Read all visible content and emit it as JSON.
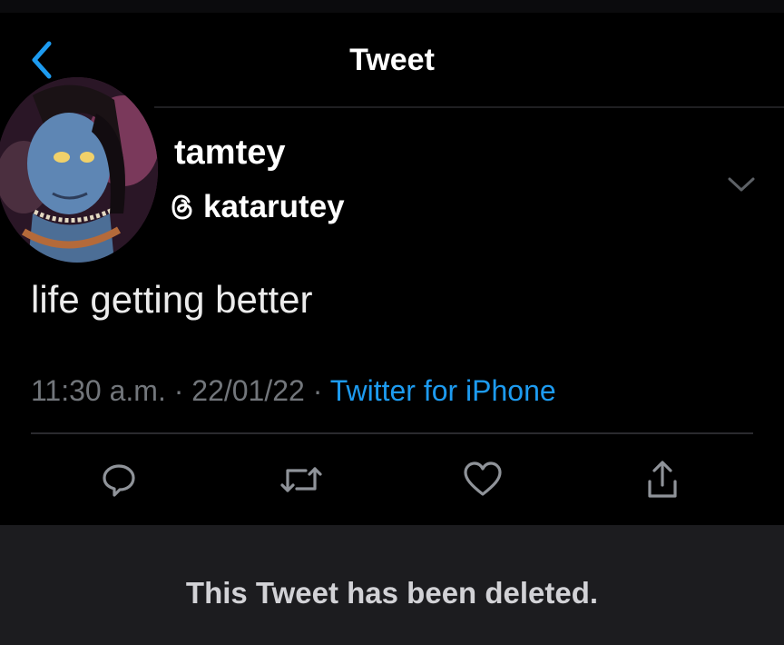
{
  "nav": {
    "title": "Tweet",
    "back_icon": "chevron-left-icon"
  },
  "tweet": {
    "display_name": "tamtey",
    "handle_prefix_icon": "threads-logo-icon",
    "handle": "katarutey",
    "text": "life getting better",
    "time": "11:30 a.m.",
    "separator": "·",
    "date": "22/01/22",
    "source": "Twitter for iPhone"
  },
  "actions": [
    "reply-icon",
    "retweet-icon",
    "like-icon",
    "share-icon"
  ],
  "deleted_notice": "This Tweet has been deleted.",
  "colors": {
    "background": "#000000",
    "link": "#1d9bf0",
    "muted": "#72767b",
    "notice_bg": "#1c1c1f",
    "back_icon": "#1d9bf0"
  }
}
